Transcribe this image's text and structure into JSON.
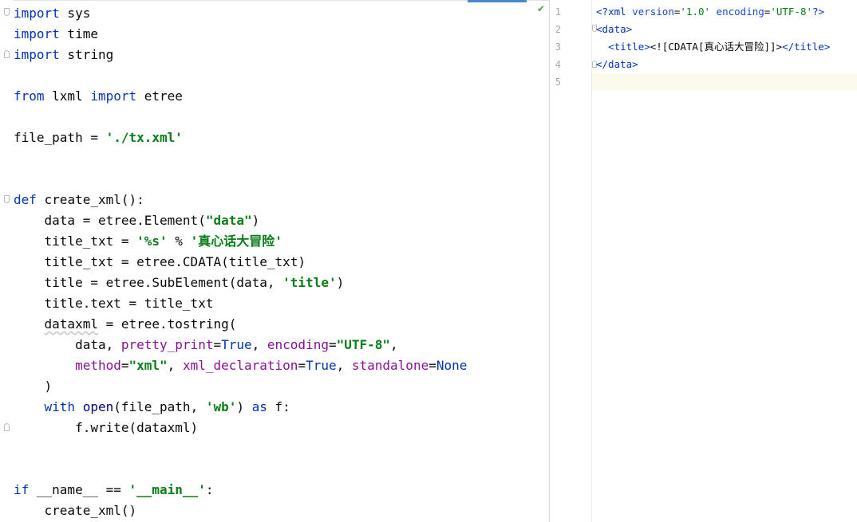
{
  "python_editor": {
    "status_icon": "✔",
    "lines": [
      [
        {
          "t": "import",
          "c": "kw"
        },
        {
          "t": " sys",
          "c": ""
        }
      ],
      [
        {
          "t": "import",
          "c": "kw"
        },
        {
          "t": " time",
          "c": ""
        }
      ],
      [
        {
          "t": "import",
          "c": "kw"
        },
        {
          "t": " string",
          "c": ""
        }
      ],
      [],
      [
        {
          "t": "from",
          "c": "kw"
        },
        {
          "t": " lxml ",
          "c": ""
        },
        {
          "t": "import",
          "c": "kw"
        },
        {
          "t": " etree",
          "c": ""
        }
      ],
      [],
      [
        {
          "t": "file_path = ",
          "c": ""
        },
        {
          "t": "'./tx.xml'",
          "c": "str"
        }
      ],
      [],
      [],
      [
        {
          "t": "def",
          "c": "kw"
        },
        {
          "t": " create_xml():",
          "c": ""
        }
      ],
      [
        {
          "t": "    data = etree.Element(",
          "c": ""
        },
        {
          "t": "\"data\"",
          "c": "str"
        },
        {
          "t": ")",
          "c": ""
        }
      ],
      [
        {
          "t": "    title_txt = ",
          "c": ""
        },
        {
          "t": "'%s'",
          "c": "str"
        },
        {
          "t": " % ",
          "c": ""
        },
        {
          "t": "'真心话大冒险'",
          "c": "str"
        }
      ],
      [
        {
          "t": "    title_txt = etree.CDATA(title_txt)",
          "c": ""
        }
      ],
      [
        {
          "t": "    title = etree.SubElement(data, ",
          "c": ""
        },
        {
          "t": "'title'",
          "c": "str"
        },
        {
          "t": ")",
          "c": ""
        }
      ],
      [
        {
          "t": "    title.text = title_txt",
          "c": ""
        }
      ],
      [
        {
          "t": "    ",
          "c": ""
        },
        {
          "t": "dataxml",
          "c": "squiggle"
        },
        {
          "t": " = etree.tostring(",
          "c": ""
        }
      ],
      [
        {
          "t": "        data, ",
          "c": ""
        },
        {
          "t": "pretty_print",
          "c": "param"
        },
        {
          "t": "=",
          "c": ""
        },
        {
          "t": "True",
          "c": "kw"
        },
        {
          "t": ", ",
          "c": ""
        },
        {
          "t": "encoding",
          "c": "param"
        },
        {
          "t": "=",
          "c": ""
        },
        {
          "t": "\"UTF-8\"",
          "c": "str"
        },
        {
          "t": ",",
          "c": ""
        }
      ],
      [
        {
          "t": "        ",
          "c": ""
        },
        {
          "t": "method",
          "c": "param"
        },
        {
          "t": "=",
          "c": ""
        },
        {
          "t": "\"xml\"",
          "c": "str"
        },
        {
          "t": ", ",
          "c": ""
        },
        {
          "t": "xml_declaration",
          "c": "param"
        },
        {
          "t": "=",
          "c": ""
        },
        {
          "t": "True",
          "c": "kw"
        },
        {
          "t": ", ",
          "c": ""
        },
        {
          "t": "standalone",
          "c": "param"
        },
        {
          "t": "=",
          "c": ""
        },
        {
          "t": "None",
          "c": "kw"
        }
      ],
      [
        {
          "t": "    )",
          "c": ""
        }
      ],
      [
        {
          "t": "    ",
          "c": ""
        },
        {
          "t": "with",
          "c": "kw"
        },
        {
          "t": " ",
          "c": ""
        },
        {
          "t": "open",
          "c": "builtin"
        },
        {
          "t": "(file_path, ",
          "c": ""
        },
        {
          "t": "'wb'",
          "c": "str"
        },
        {
          "t": ") ",
          "c": ""
        },
        {
          "t": "as",
          "c": "kw"
        },
        {
          "t": " f:",
          "c": ""
        }
      ],
      [
        {
          "t": "        f.write(dataxml)",
          "c": ""
        }
      ],
      [],
      [],
      [
        {
          "t": "if",
          "c": "kw"
        },
        {
          "t": " __name__ == ",
          "c": ""
        },
        {
          "t": "'__main__'",
          "c": "str"
        },
        {
          "t": ":",
          "c": ""
        }
      ],
      [
        {
          "t": "    create_xml()",
          "c": ""
        }
      ]
    ]
  },
  "xml_editor": {
    "line_numbers": [
      "1",
      "2",
      "3",
      "4",
      "5"
    ],
    "lines": [
      [
        {
          "t": "<?",
          "c": "tag"
        },
        {
          "t": "xml ",
          "c": "tag"
        },
        {
          "t": "version",
          "c": "attr"
        },
        {
          "t": "=",
          "c": ""
        },
        {
          "t": "'1.0'",
          "c": "attrval"
        },
        {
          "t": " ",
          "c": ""
        },
        {
          "t": "encoding",
          "c": "attr"
        },
        {
          "t": "=",
          "c": ""
        },
        {
          "t": "'UTF-8'",
          "c": "attrval"
        },
        {
          "t": "?>",
          "c": "tag"
        }
      ],
      [
        {
          "t": "<data>",
          "c": "tag"
        }
      ],
      [
        {
          "t": "  ",
          "c": ""
        },
        {
          "t": "<title>",
          "c": "tag"
        },
        {
          "t": "<![CDATA[真心话大冒险]]>",
          "c": ""
        },
        {
          "t": "</title>",
          "c": "tag"
        }
      ],
      [
        {
          "t": "</data>",
          "c": "tag"
        }
      ],
      []
    ]
  }
}
